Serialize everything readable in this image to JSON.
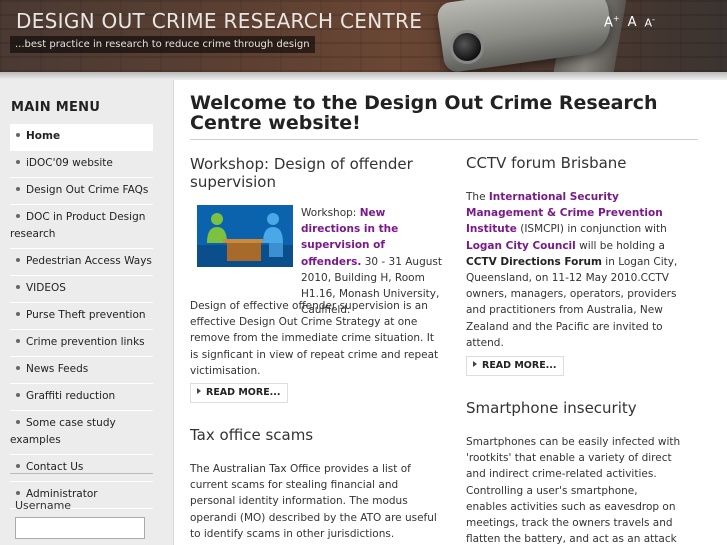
{
  "header": {
    "title": "DESIGN OUT CRIME RESEARCH CENTRE",
    "tagline": "...best practice in research to reduce crime through design",
    "font_large": "A",
    "font_normal": "A",
    "font_small": "A",
    "font_large_sup": "+",
    "font_small_sup": "-"
  },
  "sidebar": {
    "title": "MAIN MENU",
    "items": [
      {
        "label": "Home",
        "active": true
      },
      {
        "label": "iDOC'09 website"
      },
      {
        "label": "Design Out Crime FAQs"
      },
      {
        "label": "DOC in Product Design research"
      },
      {
        "label": "Pedestrian Access Ways"
      },
      {
        "label": "VIDEOS"
      },
      {
        "label": "Purse Theft prevention"
      },
      {
        "label": "Crime prevention links"
      },
      {
        "label": "News Feeds"
      },
      {
        "label": "Graffiti reduction"
      },
      {
        "label": "Some case study examples"
      },
      {
        "label": "Contact Us"
      },
      {
        "label": "Administrator"
      }
    ],
    "login": {
      "username_label": "Username"
    }
  },
  "main": {
    "page_title": "Welcome to the Design Out Crime Research Centre website!",
    "articles": {
      "workshop": {
        "title": "Workshop: Design of offender supervision",
        "intro_prefix": "Workshop: ",
        "intro_link": "New directions in the supervision of offenders.",
        "intro_rest": " 30 - 31 August 2010, Building H, Room H1.16, Monash University, Caulfield.",
        "body": "Design of effective offender supervision is an effective Design Out Crime Strategy at one remove from the immediate crime situation. It is signficant in view of repeat crime and repeat victimisation.",
        "read_more": "READ MORE..."
      },
      "tax": {
        "title": "Tax office scams",
        "body": "The Australian Tax Office provides a list of current scams for stealing financial  and personal identity information. The modus operandi (MO) described by the ATO are useful to identify scams in other jurisdictions."
      },
      "cctv": {
        "title": "CCTV forum Brisbane",
        "p1": "The ",
        "link1": "International Security Management & Crime Prevention Institute",
        "p2": " (ISMCPI) in conjunction with ",
        "link2": "Logan City Council",
        "p3": " will be holding a ",
        "bold1": "CCTV Directions Forum",
        "p4": " in Logan City, Queensland, on 11-12 May 2010.CCTV owners, managers, operators, providers and practitioners from Australia, New Zealand and the Pacific are invited to attend.",
        "read_more": "READ MORE..."
      },
      "smartphone": {
        "title": "Smartphone insecurity",
        "body": "Smartphones can be easily infected with 'rootkits' that enable a variety of direct and indirect crime-related activities. Controlling a user's smartphone, enables activities such as eavesdrop on meetings, track the owners travels and flatten the battery, and act as an attack vector via"
      }
    }
  }
}
